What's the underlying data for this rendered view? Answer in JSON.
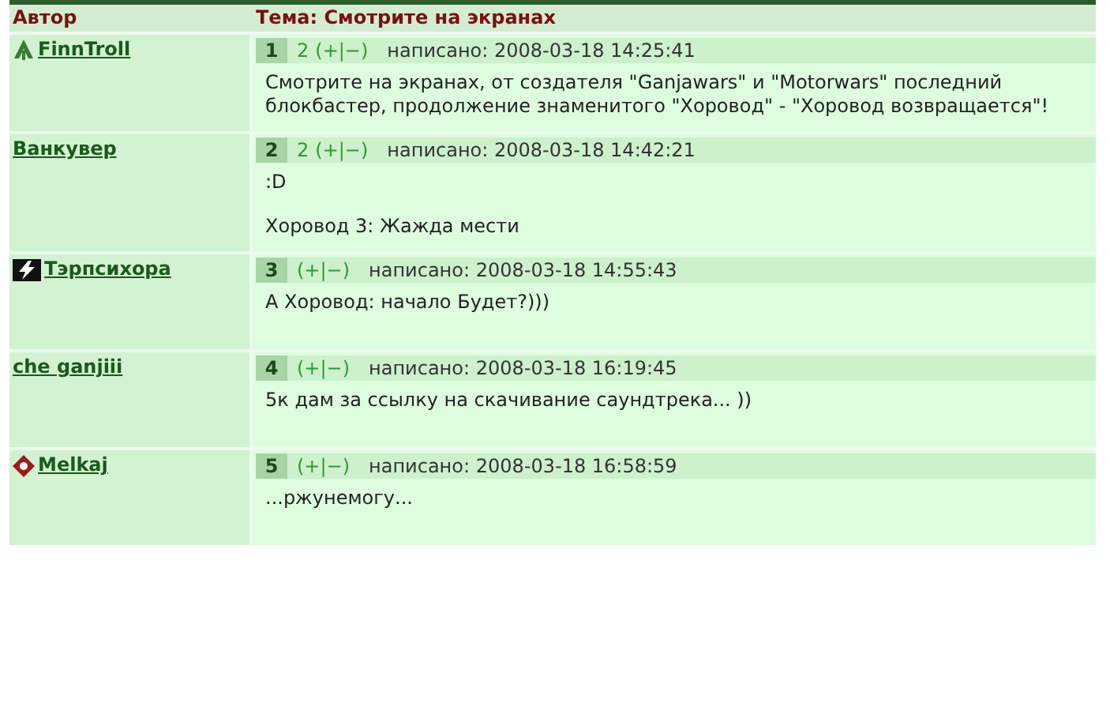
{
  "header": {
    "author_label": "Автор",
    "topic_label": "Тема: Смотрите на экранах"
  },
  "posts": [
    {
      "author": "FinnTroll",
      "kind": "tree",
      "number": "1",
      "score": "2",
      "vote": "(+|−)",
      "posted": "написано: 2008-03-18 14:25:41",
      "body": [
        "Смотрите на экранах, от создателя \"Ganjawars\" и \"Motorwars\" последний блокбастер, продолжение знаменитого \"Хоровод\" - \"Хоровод возвращается\"!"
      ]
    },
    {
      "author": "Ванкувер",
      "kind": "plain",
      "number": "2",
      "score": "2",
      "vote": "(+|−)",
      "posted": "написано: 2008-03-18 14:42:21",
      "body": [
        ":D",
        "Хоровод 3: Жажда мести"
      ]
    },
    {
      "author": "Тэрпсихора",
      "kind": "bolt",
      "number": "3",
      "vote": "(+|−)",
      "posted": "написано: 2008-03-18 14:55:43",
      "body": [
        "А Хоровод: начало Будет?)))"
      ]
    },
    {
      "author": "che ganjiii",
      "kind": "plain",
      "number": "4",
      "vote": "(+|−)",
      "posted": "написано: 2008-03-18 16:19:45",
      "body": [
        "5к дам за ссылку на скачивание саундтрека... ))"
      ]
    },
    {
      "author": "Melkaj",
      "kind": "diamond",
      "number": "5",
      "vote": "(+|−)",
      "posted": "написано: 2008-03-18 16:58:59",
      "body": [
        "...ржунемогу..."
      ]
    }
  ]
}
